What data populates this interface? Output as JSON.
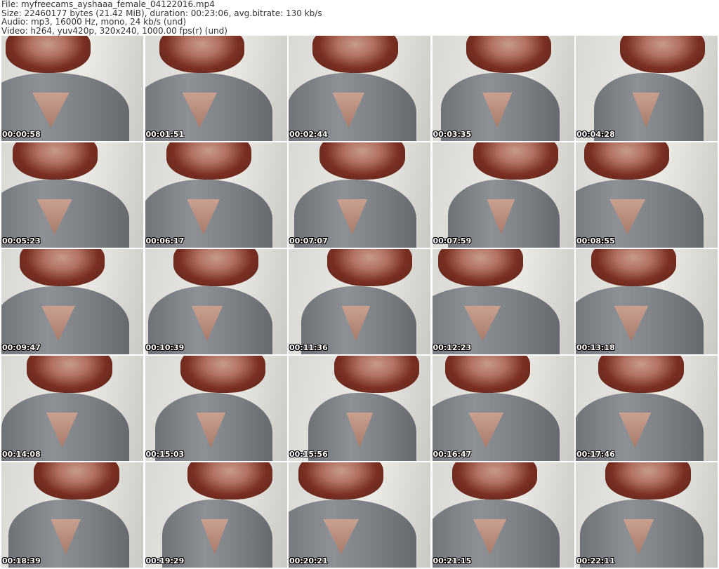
{
  "header": {
    "file": "File: myfreecams_ayshaaa_female_04122016.mp4",
    "size": "Size: 22460177 bytes (21.42 MiB), duration: 00:23:06, avg.bitrate: 130 kb/s",
    "audio": "Audio: mp3, 16000 Hz, mono, 24 kb/s (und)",
    "video": "Video: h264, yuv420p, 320x240, 1000.00 fps(r) (und)"
  },
  "thumbnails": [
    "00:00:58",
    "00:01:51",
    "00:02:44",
    "00:03:35",
    "00:04:28",
    "00:05:23",
    "00:06:17",
    "00:07:07",
    "00:07:59",
    "00:08:55",
    "00:09:47",
    "00:10:39",
    "00:11:36",
    "00:12:23",
    "00:13:18",
    "00:14:08",
    "00:15:03",
    "00:15:56",
    "00:16:47",
    "00:17:46",
    "00:18:39",
    "00:19:29",
    "00:20:21",
    "00:21:15",
    "00:22:11"
  ]
}
